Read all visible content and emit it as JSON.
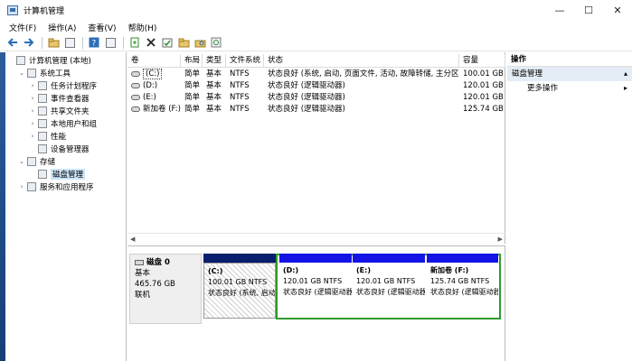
{
  "window": {
    "title": "计算机管理",
    "controls": {
      "minimize": "—",
      "maximize": "☐",
      "close": "✕"
    }
  },
  "menu": [
    "文件(F)",
    "操作(A)",
    "查看(V)",
    "帮助(H)"
  ],
  "toolbar_icons": [
    "back-arrow-icon",
    "forward-arrow-icon",
    "folder-up-icon",
    "console-tree-icon",
    "help-icon",
    "properties-icon",
    "export-icon",
    "delete-icon",
    "check-disk-icon",
    "open-folder-icon",
    "folder-search-icon",
    "zoom-icon"
  ],
  "tree": [
    {
      "label": "计算机管理 (本地)",
      "level": 0,
      "expander": "",
      "icon": "computer-icon"
    },
    {
      "label": "系统工具",
      "level": 1,
      "expander": "⌄",
      "icon": "tools-icon"
    },
    {
      "label": "任务计划程序",
      "level": 2,
      "expander": "›",
      "icon": "clock-icon"
    },
    {
      "label": "事件查看器",
      "level": 2,
      "expander": "›",
      "icon": "event-viewer-icon"
    },
    {
      "label": "共享文件夹",
      "level": 2,
      "expander": "›",
      "icon": "shared-folder-icon"
    },
    {
      "label": "本地用户和组",
      "level": 2,
      "expander": "›",
      "icon": "users-icon"
    },
    {
      "label": "性能",
      "level": 2,
      "expander": "›",
      "icon": "performance-icon"
    },
    {
      "label": "设备管理器",
      "level": 2,
      "expander": "",
      "icon": "device-manager-icon"
    },
    {
      "label": "存储",
      "level": 1,
      "expander": "⌄",
      "icon": "storage-icon"
    },
    {
      "label": "磁盘管理",
      "level": 2,
      "expander": "",
      "icon": "disk-management-icon",
      "selected": true
    },
    {
      "label": "服务和应用程序",
      "level": 1,
      "expander": "›",
      "icon": "services-icon"
    }
  ],
  "volumes": {
    "columns": [
      "卷",
      "布局",
      "类型",
      "文件系统",
      "状态",
      "容量"
    ],
    "rows": [
      [
        "(C:)",
        "简单",
        "基本",
        "NTFS",
        "状态良好 (系统, 启动, 页面文件, 活动, 故障转储, 主分区)",
        "100.01 GB"
      ],
      [
        "(D:)",
        "简单",
        "基本",
        "NTFS",
        "状态良好 (逻辑驱动器)",
        "120.01 GB"
      ],
      [
        "(E:)",
        "简单",
        "基本",
        "NTFS",
        "状态良好 (逻辑驱动器)",
        "120.01 GB"
      ],
      [
        "新加卷 (F:)",
        "简单",
        "基本",
        "NTFS",
        "状态良好 (逻辑驱动器)",
        "125.74 GB"
      ]
    ]
  },
  "disk": {
    "name": "磁盘 0",
    "type": "基本",
    "size": "465.76 GB",
    "state": "联机"
  },
  "partitions": [
    {
      "name": "(C:)",
      "size": "100.01 GB NTFS",
      "status": "状态良好 (系统, 启动, 页面文件, 活动, 故障转储, 主分区)",
      "bar_color": "#0a1e6e"
    },
    {
      "name": "(D:)",
      "size": "120.01 GB NTFS",
      "status": "状态良好 (逻辑驱动器)",
      "bar_color": "#1414e6"
    },
    {
      "name": "(E:)",
      "size": "120.01 GB NTFS",
      "status": "状态良好 (逻辑驱动器)",
      "bar_color": "#1414e6"
    },
    {
      "name": "新加卷 (F:)",
      "size": "125.74 GB NTFS",
      "status": "状态良好 (逻辑驱动器)",
      "bar_color": "#1414e6"
    }
  ],
  "actions": {
    "title": "操作",
    "section": "磁盘管理",
    "more": "更多操作"
  },
  "colors": {
    "extended_partition_border": "#2e9a2e",
    "selection": "#cce4f7",
    "action_section_bg": "#e4ecf5"
  }
}
